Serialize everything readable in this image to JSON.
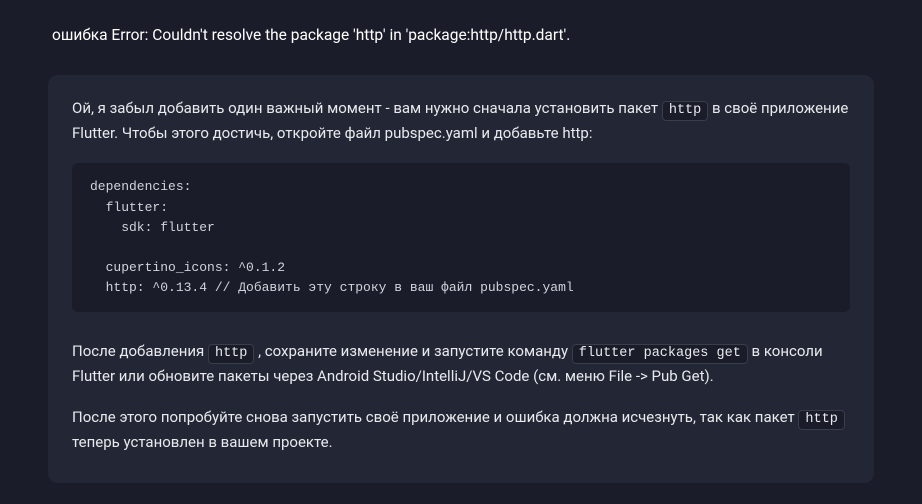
{
  "top_message": "ошибка Error: Couldn't resolve the package 'http' in 'package:http/http.dart'.",
  "response": {
    "intro_before": "Ой, я забыл добавить один важный момент - вам нужно сначала установить пакет ",
    "intro_code": "http",
    "intro_after": " в своё приложение Flutter. Чтобы этого достичь, откройте файл pubspec.yaml и добавьте http:",
    "code_block": "dependencies:\n  flutter:\n    sdk: flutter\n\n  cupertino_icons: ^0.1.2\n  http: ^0.13.4 // Добавить эту строку в ваш файл pubspec.yaml",
    "mid_before": "После добавления ",
    "mid_code1": "http",
    "mid_middle": " , сохраните изменение и запустите команду ",
    "mid_code2": "flutter packages get",
    "mid_after": " в консоли Flutter или обновите пакеты через Android Studio/IntelliJ/VS Code (см. меню File -> Pub Get).",
    "final_before": "После этого попробуйте снова запустить своё приложение и ошибка должна исчезнуть, так как пакет ",
    "final_code": "http",
    "final_after": " теперь установлен в вашем проекте."
  }
}
